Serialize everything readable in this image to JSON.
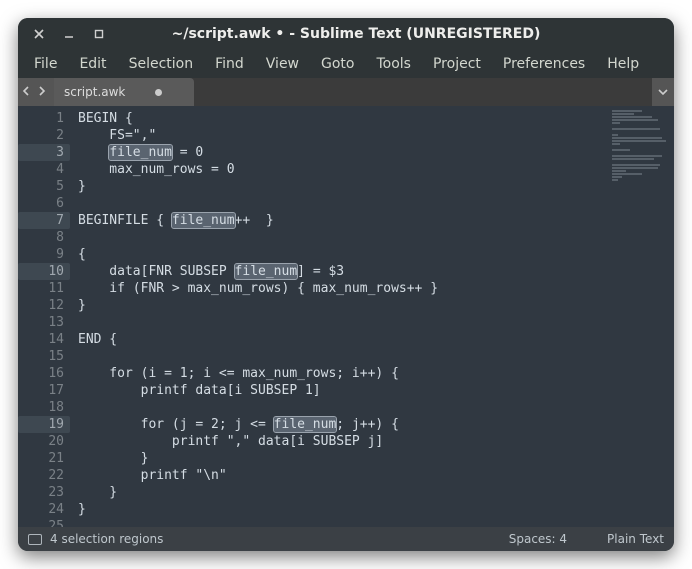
{
  "window": {
    "title": "~/script.awk • - Sublime Text (UNREGISTERED)"
  },
  "menu": {
    "items": [
      "File",
      "Edit",
      "Selection",
      "Find",
      "View",
      "Goto",
      "Tools",
      "Project",
      "Preferences",
      "Help"
    ]
  },
  "tab": {
    "name": "script.awk",
    "dirty": true
  },
  "editor": {
    "highlighted_lines": [
      3,
      7,
      10,
      19
    ],
    "selection_token": "file_num",
    "lines": [
      "BEGIN {",
      "    FS=\",\"",
      "    file_num = 0",
      "    max_num_rows = 0",
      "}",
      "",
      "BEGINFILE { file_num++  }",
      "",
      "{",
      "    data[FNR SUBSEP file_num] = $3",
      "    if (FNR > max_num_rows) { max_num_rows++ }",
      "}",
      "",
      "END {",
      "",
      "    for (i = 1; i <= max_num_rows; i++) {",
      "        printf data[i SUBSEP 1]",
      "",
      "        for (j = 2; j <= file_num; j++) {",
      "            printf \",\" data[i SUBSEP j]",
      "        }",
      "        printf \"\\n\"",
      "    }",
      "}",
      ""
    ]
  },
  "statusbar": {
    "left": "4 selection regions",
    "spaces": "Spaces: 4",
    "syntax": "Plain Text"
  },
  "colors": {
    "bg": "#303841",
    "fg": "#d5dde4",
    "selection": "#5a6470"
  }
}
